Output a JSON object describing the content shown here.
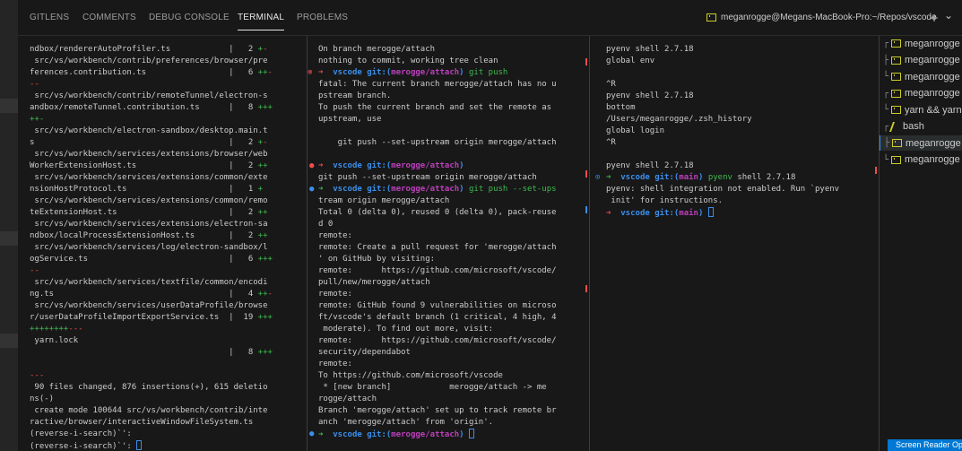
{
  "panel_tabs": [
    "GITLENS",
    "COMMENTS",
    "DEBUG CONSOLE",
    "TERMINAL",
    "PROBLEMS"
  ],
  "terminal_title": "meganrogge@Megans-MacBook-Pro:~/Repos/vscode",
  "toolbar": {
    "add_icon": "+",
    "dropdown_icon": "⌄"
  },
  "pane1": [
    [
      {
        "t": "ndbox/rendererAutoProfiler.ts            |   2 "
      },
      {
        "t": "+",
        "c": "g"
      },
      {
        "t": "-",
        "c": "r"
      }
    ],
    [
      {
        "t": " src/vs/workbench/contrib/preferences/browser/pre"
      }
    ],
    [
      {
        "t": "ferences.contribution.ts                 |   6 "
      },
      {
        "t": "++",
        "c": "g"
      },
      {
        "t": "-",
        "c": "r"
      }
    ],
    [
      {
        "t": "--",
        "c": "r"
      }
    ],
    [
      {
        "t": " src/vs/workbench/contrib/remoteTunnel/electron-s"
      }
    ],
    [
      {
        "t": "andbox/remoteTunnel.contribution.ts      |   8 "
      },
      {
        "t": "+++",
        "c": "g"
      }
    ],
    [
      {
        "t": "++-",
        "c": "g"
      }
    ],
    [
      {
        "t": " src/vs/workbench/electron-sandbox/desktop.main.t"
      }
    ],
    [
      {
        "t": "s                                        |   2 "
      },
      {
        "t": "+",
        "c": "g"
      },
      {
        "t": "-",
        "c": "r"
      }
    ],
    [
      {
        "t": " src/vs/workbench/services/extensions/browser/web"
      }
    ],
    [
      {
        "t": "WorkerExtensionHost.ts                   |   2 "
      },
      {
        "t": "++",
        "c": "g"
      }
    ],
    [
      {
        "t": " src/vs/workbench/services/extensions/common/exte"
      }
    ],
    [
      {
        "t": "nsionHostProtocol.ts                     |   1 "
      },
      {
        "t": "+",
        "c": "g"
      }
    ],
    [
      {
        "t": " src/vs/workbench/services/extensions/common/remo"
      }
    ],
    [
      {
        "t": "teExtensionHost.ts                       |   2 "
      },
      {
        "t": "++",
        "c": "g"
      }
    ],
    [
      {
        "t": " src/vs/workbench/services/extensions/electron-sa"
      }
    ],
    [
      {
        "t": "ndbox/localProcessExtensionHost.ts       |   2 "
      },
      {
        "t": "++",
        "c": "g"
      }
    ],
    [
      {
        "t": " src/vs/workbench/services/log/electron-sandbox/l"
      }
    ],
    [
      {
        "t": "ogService.ts                             |   6 "
      },
      {
        "t": "+++",
        "c": "g"
      }
    ],
    [
      {
        "t": "--",
        "c": "r"
      }
    ],
    [
      {
        "t": " src/vs/workbench/services/textfile/common/encodi"
      }
    ],
    [
      {
        "t": "ng.ts                                    |   4 "
      },
      {
        "t": "++",
        "c": "g"
      },
      {
        "t": "-",
        "c": "r"
      }
    ],
    [
      {
        "t": " src/vs/workbench/services/userDataProfile/browse"
      }
    ],
    [
      {
        "t": "r/userDataProfileImportExportService.ts  |  19 "
      },
      {
        "t": "+++",
        "c": "g"
      }
    ],
    [
      {
        "t": "++++++++",
        "c": "g"
      },
      {
        "t": "---",
        "c": "r"
      }
    ],
    [
      {
        "t": " yarn.lock"
      }
    ],
    [
      {
        "t": "                                         |   8 "
      },
      {
        "t": "+++",
        "c": "g"
      }
    ],
    [
      {
        "t": ""
      }
    ],
    [
      {
        "t": "---",
        "c": "r"
      }
    ],
    [
      {
        "t": " 90 files changed, 876 insertions(+), 615 deletio"
      }
    ],
    [
      {
        "t": "ns(-)"
      }
    ],
    [
      {
        "t": " create mode 100644 src/vs/workbench/contrib/inte"
      }
    ],
    [
      {
        "t": "ractive/browser/interactiveWindowFileSystem.ts"
      }
    ],
    [
      {
        "t": "(reverse-i-search)`': "
      }
    ],
    [
      {
        "t": "(reverse-i-search)`': "
      },
      {
        "cursor": true
      }
    ]
  ],
  "pane2": [
    [
      {
        "t": "On branch merogge/attach"
      }
    ],
    [
      {
        "t": "nothing to commit, working tree clean"
      }
    ],
    [
      {
        "t": "➜  ",
        "c": "r"
      },
      {
        "t": "vscode ",
        "c": "c"
      },
      {
        "t": "git:(",
        "c": "c"
      },
      {
        "t": "merogge/attach",
        "c": "m"
      },
      {
        "t": ") ",
        "c": "c"
      },
      {
        "t": "git push",
        "c": "g"
      }
    ],
    [
      {
        "t": "fatal: The current branch merogge/attach has no u"
      }
    ],
    [
      {
        "t": "pstream branch."
      }
    ],
    [
      {
        "t": "To push the current branch and set the remote as"
      }
    ],
    [
      {
        "t": "upstream, use"
      }
    ],
    [
      {
        "t": ""
      }
    ],
    [
      {
        "t": "    git push --set-upstream origin merogge/attach"
      }
    ],
    [
      {
        "t": ""
      }
    ],
    [
      {
        "t": "➜  ",
        "c": "r"
      },
      {
        "t": "vscode ",
        "c": "c"
      },
      {
        "t": "git:(",
        "c": "c"
      },
      {
        "t": "merogge/attach",
        "c": "m"
      },
      {
        "t": ")",
        "c": "c"
      }
    ],
    [
      {
        "t": "git push --set-upstream origin merogge/attach"
      }
    ],
    [
      {
        "t": "➜  ",
        "c": "g"
      },
      {
        "t": "vscode ",
        "c": "c"
      },
      {
        "t": "git:(",
        "c": "c"
      },
      {
        "t": "merogge/attach",
        "c": "m"
      },
      {
        "t": ") ",
        "c": "c"
      },
      {
        "t": "git push --set-ups",
        "c": "g"
      }
    ],
    [
      {
        "t": "tream origin merogge/attach"
      }
    ],
    [
      {
        "t": "Total 0 (delta 0), reused 0 (delta 0), pack-reuse"
      }
    ],
    [
      {
        "t": "d 0"
      }
    ],
    [
      {
        "t": "remote:"
      }
    ],
    [
      {
        "t": "remote: Create a pull request for 'merogge/attach"
      }
    ],
    [
      {
        "t": "' on GitHub by visiting:"
      }
    ],
    [
      {
        "t": "remote:      https://github.com/microsoft/vscode/"
      }
    ],
    [
      {
        "t": "pull/new/merogge/attach"
      }
    ],
    [
      {
        "t": "remote:"
      }
    ],
    [
      {
        "t": "remote: GitHub found 9 vulnerabilities on microso"
      }
    ],
    [
      {
        "t": "ft/vscode's default branch (1 critical, 4 high, 4"
      }
    ],
    [
      {
        "t": " moderate). To find out more, visit:"
      }
    ],
    [
      {
        "t": "remote:      https://github.com/microsoft/vscode/"
      }
    ],
    [
      {
        "t": "security/dependabot"
      }
    ],
    [
      {
        "t": "remote:"
      }
    ],
    [
      {
        "t": "To https://github.com/microsoft/vscode"
      }
    ],
    [
      {
        "t": " * [new branch]            merogge/attach -> me"
      }
    ],
    [
      {
        "t": "rogge/attach"
      }
    ],
    [
      {
        "t": "Branch 'merogge/attach' set up to track remote br"
      }
    ],
    [
      {
        "t": "anch 'merogge/attach' from 'origin'."
      }
    ],
    [
      {
        "t": "➜  ",
        "c": "g"
      },
      {
        "t": "vscode ",
        "c": "c"
      },
      {
        "t": "git:(",
        "c": "c"
      },
      {
        "t": "merogge/attach",
        "c": "m"
      },
      {
        "t": ") ",
        "c": "c"
      },
      {
        "cursor": true
      }
    ]
  ],
  "pane3": [
    [
      {
        "t": "pyenv shell 2.7.18"
      }
    ],
    [
      {
        "t": "global env"
      }
    ],
    [
      {
        "t": ""
      }
    ],
    [
      {
        "t": "^R"
      }
    ],
    [
      {
        "t": "pyenv shell 2.7.18"
      }
    ],
    [
      {
        "t": "bottom"
      }
    ],
    [
      {
        "t": "/Users/meganrogge/.zsh_history"
      }
    ],
    [
      {
        "t": "global login"
      }
    ],
    [
      {
        "t": "^R"
      }
    ],
    [
      {
        "t": ""
      }
    ],
    [
      {
        "t": "pyenv shell 2.7.18"
      }
    ],
    [
      {
        "t": "➜  ",
        "c": "g"
      },
      {
        "t": "vscode ",
        "c": "c"
      },
      {
        "t": "git:(",
        "c": "c"
      },
      {
        "t": "main",
        "c": "m"
      },
      {
        "t": ") ",
        "c": "c"
      },
      {
        "t": "pyenv",
        "c": "g"
      },
      {
        "t": " shell 2.7.18"
      }
    ],
    [
      {
        "t": "pyenv: shell integration not enabled. Run `pyenv"
      }
    ],
    [
      {
        "t": " init' for instructions."
      }
    ],
    [
      {
        "t": "➜  ",
        "c": "r"
      },
      {
        "t": "vscode ",
        "c": "c"
      },
      {
        "t": "git:(",
        "c": "c"
      },
      {
        "t": "main",
        "c": "m"
      },
      {
        "t": ") ",
        "c": "c"
      },
      {
        "cursor": true
      }
    ]
  ],
  "terminal_list": [
    {
      "tree": "┌",
      "label": "meganrogge",
      "icon": "terminal-icon"
    },
    {
      "tree": "├",
      "label": "meganrogge",
      "icon": "terminal-icon"
    },
    {
      "tree": "└",
      "label": "meganrogge",
      "icon": "terminal-icon"
    },
    {
      "tree": "┌",
      "label": "meganrogge",
      "icon": "terminal-icon"
    },
    {
      "tree": "└",
      "label": "yarn && yarn",
      "icon": "terminal-icon"
    },
    {
      "tree": "┌",
      "label": "bash",
      "icon": "bash-icon"
    },
    {
      "tree": "├",
      "label": "meganrogge",
      "icon": "terminal-icon",
      "selected": true
    },
    {
      "tree": "└",
      "label": "meganrogge",
      "icon": "terminal-icon"
    }
  ],
  "status_bar": {
    "screen_reader": "Screen Reader Optimized"
  },
  "colors": {
    "background": "#181818",
    "green": "#3fb950",
    "red": "#f14c4c",
    "cyan": "#3b8eea",
    "magenta": "#bc3fbc",
    "accent": "#0078d4"
  }
}
